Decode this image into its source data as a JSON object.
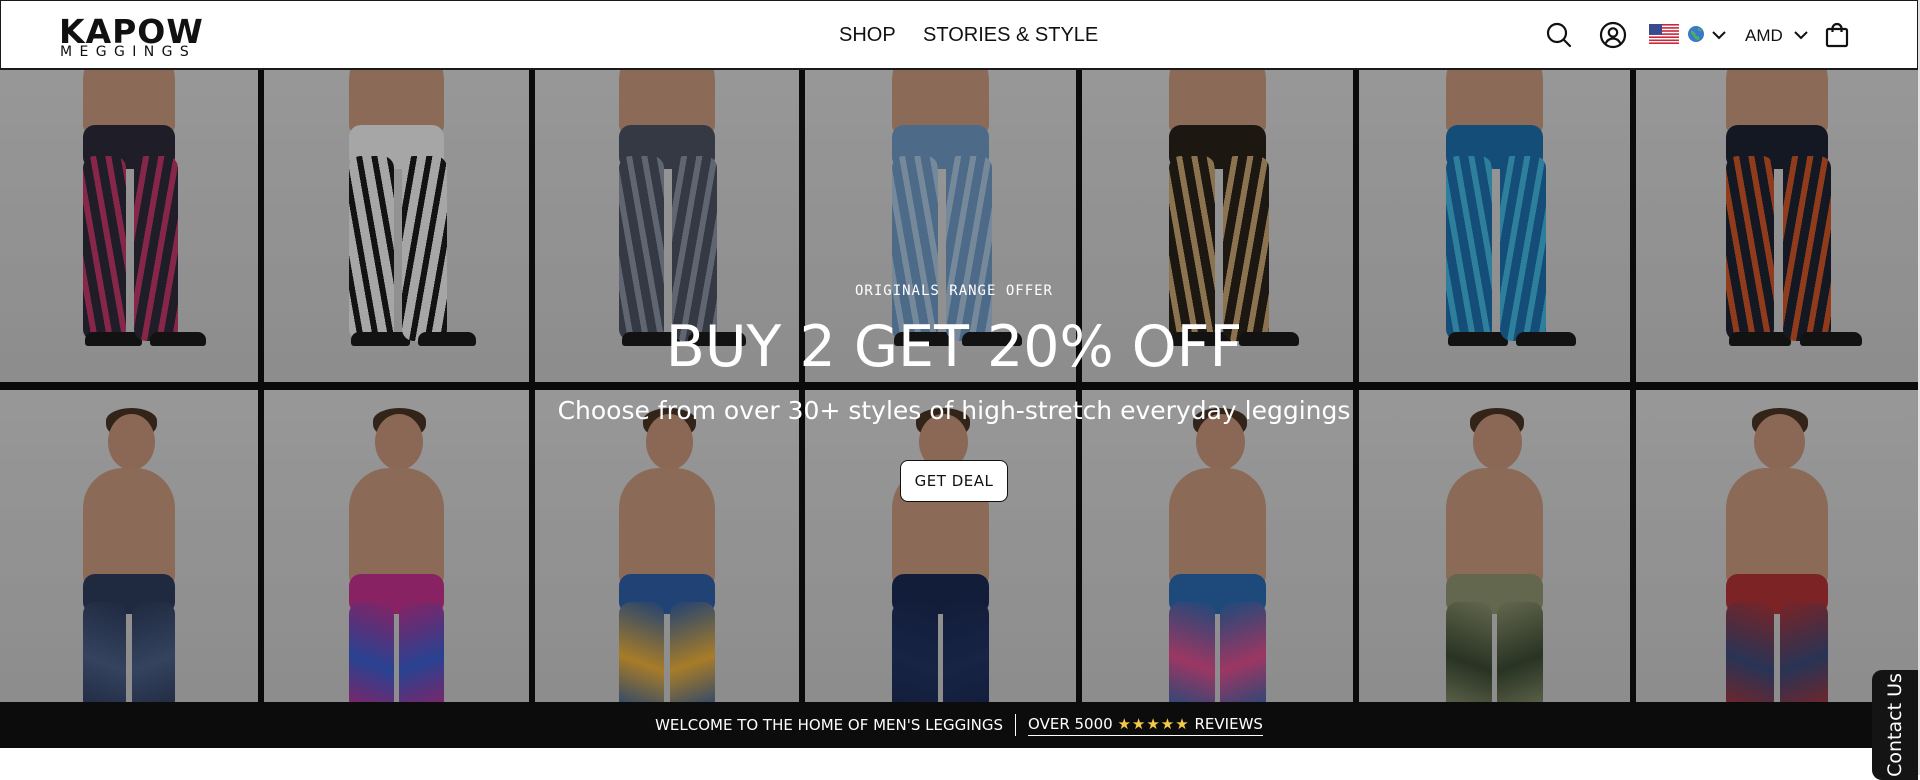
{
  "header": {
    "logo_main": "KAPOW",
    "logo_sub": "MEGGINGS",
    "nav": [
      {
        "label": "SHOP"
      },
      {
        "label": "STORIES & STYLE"
      }
    ],
    "icons": {
      "search": "search-icon",
      "account": "account-icon",
      "cart": "shopping-bag-icon"
    },
    "country_flag": "us-flag",
    "globe": "globe-icon",
    "currency": "AMD"
  },
  "hero": {
    "eyebrow": "ORIGINALS RANGE OFFER",
    "title": "BUY 2 GET 20% OFF",
    "subtitle": "Choose from over 30+ styles of high-stretch everyday leggings",
    "cta_label": "GET DEAL",
    "tiles": [
      {
        "legs": "#2b2a3a",
        "accent": "#c0396b"
      },
      {
        "legs": "#eeeeee",
        "accent": "#1a1a1a"
      },
      {
        "legs": "#4b5260",
        "accent": "#8a93a3"
      },
      {
        "legs": "#6f98c4",
        "accent": "#a9c4df"
      },
      {
        "legs": "#2a221b",
        "accent": "#c9a573"
      },
      {
        "legs": "#1f6fae",
        "accent": "#43b6e0"
      },
      {
        "legs": "#1d2332",
        "accent": "#d0552a"
      },
      {
        "legs": "#2d3c5c",
        "accent": "#4c6088"
      },
      {
        "legs": "#c4318f",
        "accent": "#3a5fd0"
      },
      {
        "legs": "#2e5fa6",
        "accent": "#f0b23a"
      },
      {
        "legs": "#1a2a52",
        "accent": "#223463"
      },
      {
        "legs": "#2a6bb0",
        "accent": "#e04f8e"
      },
      {
        "legs": "#8e9470",
        "accent": "#3b4a33"
      },
      {
        "legs": "#b13336",
        "accent": "#3a4b7a"
      }
    ]
  },
  "announcement": {
    "welcome": "WELCOME TO THE HOME OF MEN'S LEGGINGS",
    "reviews_prefix": "OVER 5000",
    "stars": "★★★★★",
    "reviews_suffix": "REVIEWS"
  },
  "contact_tab": "Contact Us",
  "colors": {
    "header_bg": "#ffffff",
    "announce_bg": "#0c0c0c",
    "star": "#f6c94a"
  }
}
